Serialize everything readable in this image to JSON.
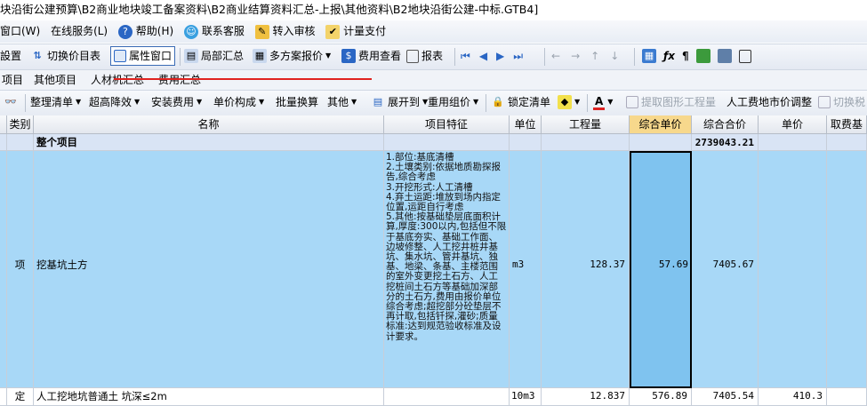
{
  "window": {
    "title": "块沿街公建预算\\B2商业地块竣工备案资料\\B2商业结算资料汇总-上报\\其他资料\\B2地块沿街公建-中标.GTB4]"
  },
  "menu": {
    "window_label": "窗口(W)",
    "online_label": "在线服务(L)",
    "help_label": "帮助(H)",
    "service_label": "联系客服",
    "review_label": "转入审核",
    "pay_label": "计量支付"
  },
  "toolbar1": {
    "settings_label": "設置",
    "switch_price_label": "切换价目表",
    "property_window_label": "属性窗口",
    "partial_summary_label": "局部汇总",
    "multi_quote_label": "多方案报价",
    "fee_view_label": "费用查看",
    "report_label": "报表"
  },
  "tabs": [
    "项目",
    "其他项目",
    "人材机汇总",
    "费用汇总"
  ],
  "toolbar2": {
    "organize_label": "整理清单",
    "height_label": "超高降效",
    "install_fee_label": "安装费用",
    "unit_compose_label": "单价构成",
    "batch_convert_label": "批量换算",
    "other_label": "其他",
    "expand_label": "展开到",
    "reuse_label": "重用组价",
    "lock_label": "锁定清单",
    "extract_label": "提取图形工程量",
    "labor_label": "人工费地市价调整",
    "switch_tax_label": "切换税"
  },
  "grid": {
    "headers": [
      "类别",
      "名称",
      "项目特征",
      "单位",
      "工程量",
      "综合单价",
      "综合合价",
      "单价",
      "取费基"
    ],
    "rows": [
      {
        "type": "",
        "name": "整个项目",
        "feature": "",
        "unit": "",
        "qty": "",
        "unit_price": "",
        "total": "2739043.21",
        "price": ""
      },
      {
        "type": "项",
        "name": "挖基坑土方",
        "feature": "1.部位:基底清槽\n2.土壤类别:依据地质勘探报告,综合考虑\n3.开挖形式:人工清槽\n4.弃土运距:堆放到场内指定位置,运距自行考虑\n5.其他:按基础垫层底面积计算,厚度:300以内,包括但不限于基底夯实、基础工作面、边坡修整、人工挖井桩井基坑、集水坑、管井基坑、独基、地梁、条基、主楼范围的室外变更挖土石方、人工挖桩间土石方等基础加深部分的土石方,费用由报价单位综合考虑;超挖部分砼垫层不再计取,包括钎探,灌砂;质量标准:达到规范验收标准及设计要求。",
        "unit": "m3",
        "qty": "128.37",
        "unit_price": "57.69",
        "total": "7405.67",
        "price": ""
      },
      {
        "type": "定",
        "name": "人工挖地坑普通土 坑深≤2m",
        "feature": "",
        "unit": "10m3",
        "qty": "12.837",
        "unit_price": "576.89",
        "total": "7405.54",
        "price": "410.3"
      }
    ]
  },
  "colors": {
    "accent_selected_column": "#f7d88c",
    "row_selected_bg": "#a8d8f7",
    "annotation_red": "#e0221e"
  }
}
